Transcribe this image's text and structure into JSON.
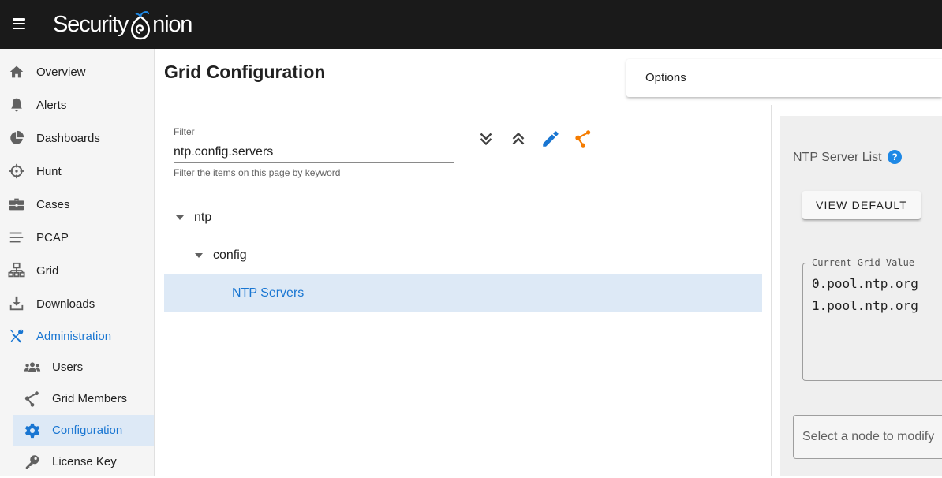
{
  "app": {
    "logo_text_left": "Security",
    "logo_text_right": "nion"
  },
  "colors": {
    "accent": "#1976d2",
    "topbar": "#1a1a1a",
    "sidebar_bg": "#f5f5f5",
    "selected_bg": "#dde9f6",
    "orange": "#f57c00",
    "help": "#1e88e5"
  },
  "sidebar": {
    "items": [
      {
        "label": "Overview",
        "icon": "home-icon"
      },
      {
        "label": "Alerts",
        "icon": "bell-icon"
      },
      {
        "label": "Dashboards",
        "icon": "pie-chart-icon"
      },
      {
        "label": "Hunt",
        "icon": "crosshairs-icon"
      },
      {
        "label": "Cases",
        "icon": "briefcase-icon"
      },
      {
        "label": "PCAP",
        "icon": "stream-icon"
      },
      {
        "label": "Grid",
        "icon": "network-icon"
      },
      {
        "label": "Downloads",
        "icon": "download-icon"
      },
      {
        "label": "Administration",
        "icon": "tools-icon"
      }
    ],
    "admin_items": [
      {
        "label": "Users",
        "icon": "users-icon"
      },
      {
        "label": "Grid Members",
        "icon": "graph-icon"
      },
      {
        "label": "Configuration",
        "icon": "gear-icon",
        "active": true
      },
      {
        "label": "License Key",
        "icon": "key-icon"
      }
    ]
  },
  "main": {
    "title": "Grid Configuration",
    "options_label": "Options",
    "filter": {
      "label": "Filter",
      "value": "ntp.config.servers",
      "hint": "Filter the items on this page by keyword"
    },
    "toolbar": [
      "expand-all-icon",
      "collapse-all-icon",
      "edit-icon",
      "share-icon"
    ],
    "tree": [
      {
        "label": "ntp",
        "level": 0,
        "expanded": true
      },
      {
        "label": "config",
        "level": 1,
        "expanded": true
      },
      {
        "label": "NTP Servers",
        "level": 2,
        "selected": true
      }
    ]
  },
  "panel": {
    "title": "NTP Server List",
    "help_glyph": "?",
    "view_default_label": "VIEW DEFAULT",
    "current_value_legend": "Current Grid Value",
    "current_value": "0.pool.ntp.org\n1.pool.ntp.org",
    "node_select_placeholder": "Select a node to modify"
  }
}
